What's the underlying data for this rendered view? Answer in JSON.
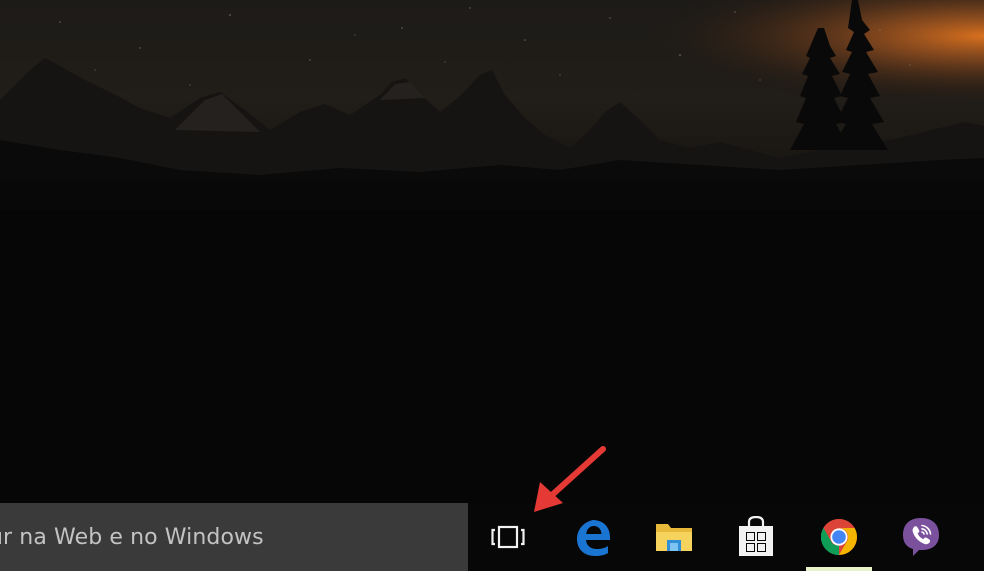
{
  "desktop": {
    "wallpaper": "night-mountain-landscape"
  },
  "taskbar": {
    "search": {
      "text": "ur na Web e no Windows"
    },
    "buttons": [
      {
        "name": "task-view",
        "icon": "task-view-icon"
      },
      {
        "name": "edge",
        "icon": "edge-icon"
      },
      {
        "name": "file-explorer",
        "icon": "folder-icon"
      },
      {
        "name": "store",
        "icon": "store-icon"
      },
      {
        "name": "chrome",
        "icon": "chrome-icon",
        "running": true
      },
      {
        "name": "viber",
        "icon": "viber-icon"
      }
    ]
  },
  "annotation": {
    "arrow_color": "#e53935",
    "points_to": "task-view-button"
  },
  "colors": {
    "taskbar": "#070707",
    "search_box": "#3a3a3a",
    "search_text": "#c3c3c3",
    "edge_blue": "#1a74d2",
    "viber_purple": "#7b519d",
    "running_indicator": "#e8f3c7"
  }
}
